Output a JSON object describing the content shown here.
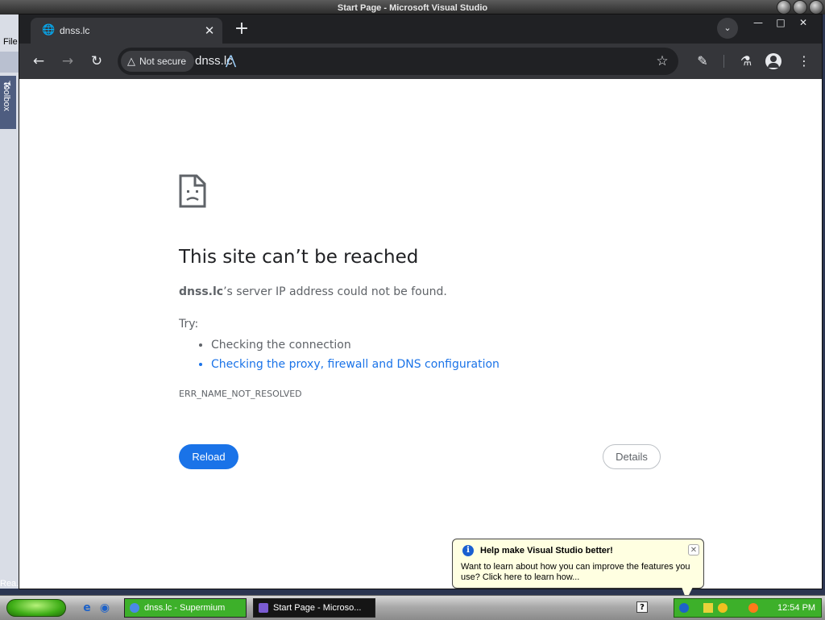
{
  "vs": {
    "title": "Start Page - Microsoft Visual Studio",
    "menu_file": "File",
    "toolbox_label": "Toolbox",
    "status": "Rea..."
  },
  "browser": {
    "tab_title": "dnss.lc",
    "security_chip": "Not secure",
    "url": "dnss.lc"
  },
  "error_page": {
    "title": "This site can’t be reached",
    "host": "dnss.lc",
    "message_rest": "’s server IP address could not be found.",
    "try_label": "Try:",
    "suggestions": [
      "Checking the connection",
      "Checking the proxy, firewall and DNS configuration"
    ],
    "error_code": "ERR_NAME_NOT_RESOLVED",
    "reload_label": "Reload",
    "details_label": "Details"
  },
  "balloon": {
    "title": "Help make Visual Studio better!",
    "text": "Want to learn about how you can improve the features you use? Click here to learn how..."
  },
  "taskbar": {
    "tasks": [
      {
        "label": "dnss.lc - Supermium"
      },
      {
        "label": "Start Page - Microso..."
      }
    ],
    "clock": "12:54 PM"
  },
  "colors": {
    "accent": "#1a73e8",
    "taskbar_green": "#3db02a",
    "chrome_dark": "#202124"
  }
}
